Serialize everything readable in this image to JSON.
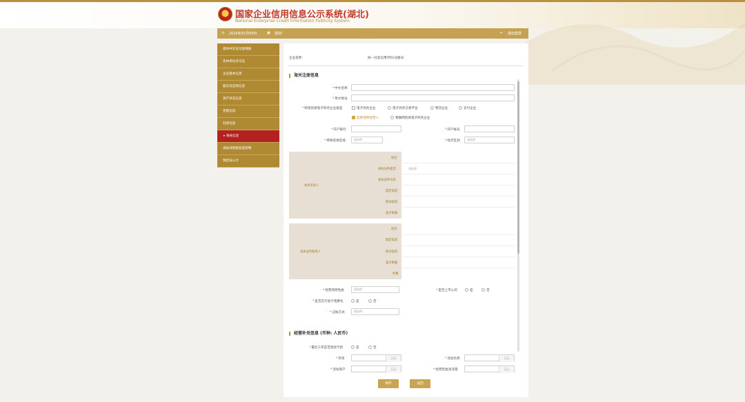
{
  "header": {
    "title": "国家企业信用信息公示系统(湖北)",
    "subtitle": "National Enterprise Credit Information Publicity System"
  },
  "infobar": {
    "date": "2024年01月09日",
    "notice": "您好!",
    "logout": "退出登录"
  },
  "sidebar": {
    "items": [
      {
        "label": "森林共享支付类填报"
      },
      {
        "label": "先林单位许可证"
      },
      {
        "label": "企业基本信息"
      },
      {
        "label": "股东及出资信息"
      },
      {
        "label": "资产状况信息"
      },
      {
        "label": "党建信息"
      },
      {
        "label": "社保信息"
      },
      {
        "label": "海关信息",
        "active": true
      },
      {
        "label": "海关减免税监督货物"
      },
      {
        "label": "预定异公示"
      }
    ]
  },
  "company": {
    "name_label": "企业名称:",
    "code_label": "统一社会信用代码/注册号:"
  },
  "customs": {
    "section_title": "海关注册信息",
    "cn_name_label": "中文名称",
    "en_name_label": "英文地址",
    "ecommerce_label": "跨境贸易电子商务企业类型",
    "ecommerce_options": [
      "电子商务企业",
      "电子商务交易平台",
      "物流企业",
      "支付企业",
      "监管场所经营人",
      "物联网贸易电子商务企业"
    ],
    "bank_label": "开户银行",
    "account_label": "开户账号",
    "trade_area_label": "特殊贸易区域",
    "economic_zone_label": "经济区划",
    "select_placeholder": "请选择",
    "principal": {
      "group_label": "关务负责人",
      "fields": [
        "姓名",
        "身份证件类型",
        "身份证件号码",
        "固定电话",
        "移动电话",
        "电子邮箱"
      ]
    },
    "contact": {
      "group_label": "海关业务联系人",
      "fields": [
        "姓名",
        "固定电话",
        "移动电话",
        "电子邮箱",
        "传真"
      ]
    },
    "premise_label": "经营场所性质",
    "listed_label": "是否上市公司",
    "accounting_label": "是否实行会计电算化",
    "bookkeeping_label": "记账方式",
    "yes": "是",
    "no": "否"
  },
  "supplement": {
    "section_title": "经营补充信息 (币种: 人民币)",
    "loss_label": "最近三年是否连续亏损",
    "stock_label": "存货",
    "current_liab_label": "流动负债",
    "current_assets_label": "流动资产",
    "cashflow_label": "经营现金净流量",
    "unit": "万元"
  },
  "buttons": {
    "save": "保存",
    "back": "返回"
  }
}
